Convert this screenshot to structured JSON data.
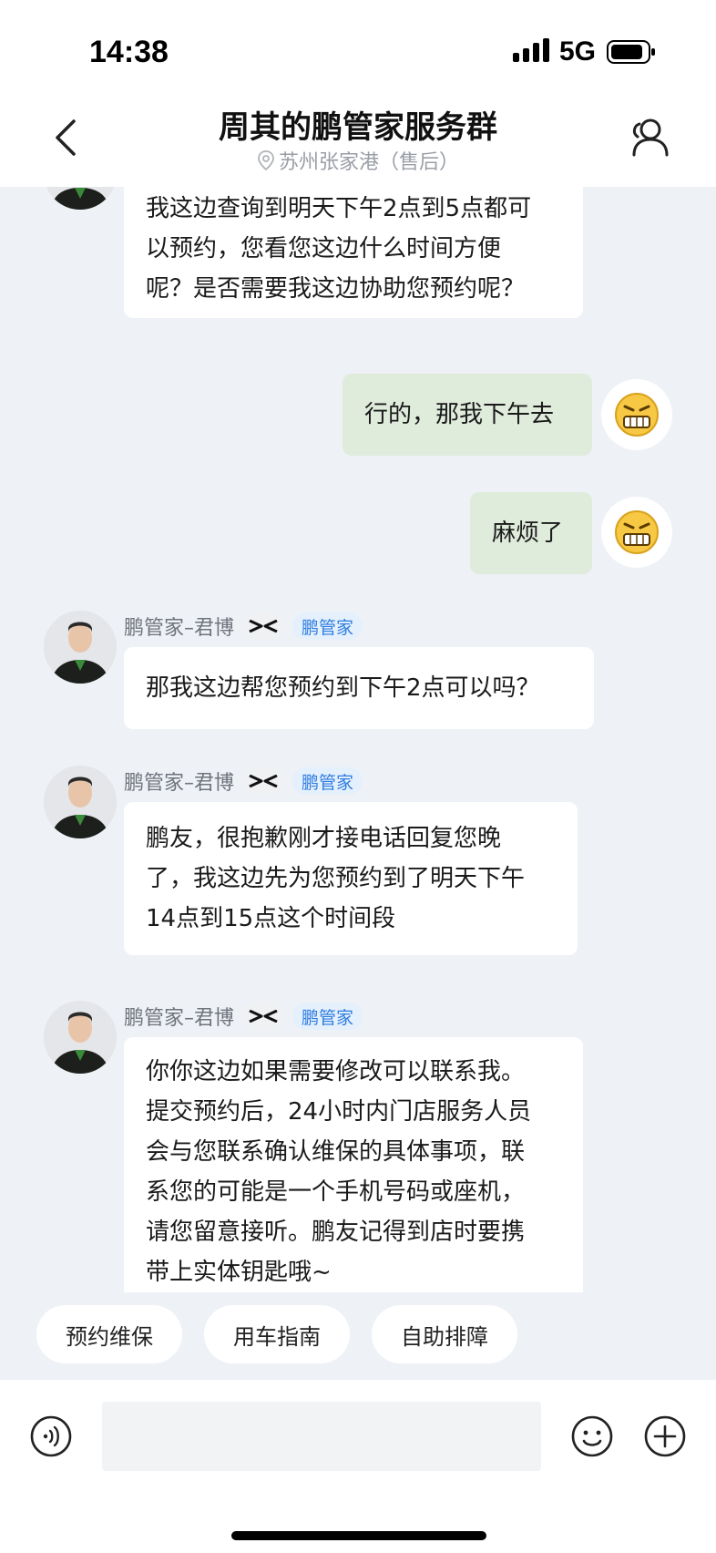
{
  "status_bar": {
    "time": "14:38",
    "network": "5G",
    "icons": [
      "signal-icon",
      "battery-icon"
    ]
  },
  "header": {
    "title": "周其的鹏管家服务群",
    "subtitle": "苏州张家港（售后）",
    "icons": [
      "back-arrow-icon",
      "location-pin-icon",
      "members-icon"
    ]
  },
  "messages": [
    {
      "from": "agent",
      "lines": [
        "我这边查询到明天下午2点到5点都可",
        "以预约，您看您这边什么时间方便",
        "呢？是否需要我这边协助您预约呢？"
      ]
    },
    {
      "from": "self",
      "lines": [
        "行的，那我下午去"
      ],
      "avatar_icon": "grimace-emoji-avatar"
    },
    {
      "from": "self",
      "lines": [
        "麻烦了"
      ],
      "avatar_icon": "grimace-emoji-avatar"
    },
    {
      "from": "agent",
      "sender_name": "鹏管家–君博",
      "role_badge": "鹏管家",
      "lines": [
        "那我这边帮您预约到下午2点可以吗？"
      ]
    },
    {
      "from": "agent",
      "sender_name": "鹏管家–君博",
      "role_badge": "鹏管家",
      "lines": [
        "鹏友，很抱歉刚才接电话回复您晚",
        "了，我这边先为您预约到了明天下午",
        "14点到15点这个时间段"
      ]
    },
    {
      "from": "agent",
      "sender_name": "鹏管家–君博",
      "role_badge": "鹏管家",
      "lines": [
        "你你这边如果需要修改可以联系我。",
        "提交预约后，24小时内门店服务人员",
        "会与您联系确认维保的具体事项，联",
        "系您的可能是一个手机号码或座机，",
        "请您留意接听。鹏友记得到店时要携",
        "带上实体钥匙哦~"
      ]
    }
  ],
  "quick_replies": [
    "预约维保",
    "用车指南",
    "自助排障"
  ],
  "input_bar": {
    "placeholder": "",
    "icons": [
      "voice-icon",
      "emoji-icon",
      "plus-icon"
    ]
  },
  "colors": {
    "chat_background": "#eef1f6",
    "self_bubble": "#dfebdb",
    "agent_bubble": "#ffffff",
    "badge_text": "#2d7de0",
    "badge_background": "#e5f0fd"
  }
}
